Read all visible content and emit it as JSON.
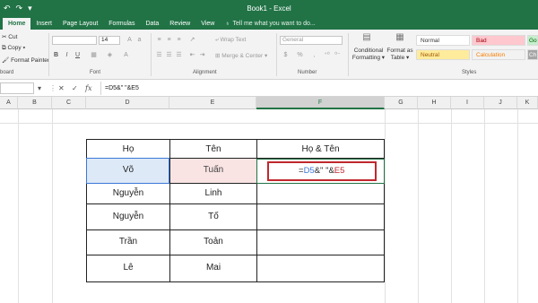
{
  "title_bar": {
    "book_title": "Book1 - Excel"
  },
  "tabs": [
    "Home",
    "Insert",
    "Page Layout",
    "Formulas",
    "Data",
    "Review",
    "View"
  ],
  "tell_me": "Tell me what you want to do...",
  "clipboard": {
    "cut": "Cut",
    "copy": "Copy",
    "format_painter": "Format Painter",
    "label": "board"
  },
  "font": {
    "size": "14",
    "bold": "B",
    "italic": "I",
    "underline": "U",
    "label": "Font"
  },
  "alignment": {
    "wrap_text": "Wrap Text",
    "merge_center": "Merge & Center",
    "label": "Alignment"
  },
  "number": {
    "format": "General",
    "currency": "$",
    "percent": "%",
    "comma": ",",
    "label": "Number"
  },
  "styles": {
    "conditional_formatting": [
      "Conditional",
      "Formatting"
    ],
    "format_as_table": [
      "Format as",
      "Table"
    ],
    "normal": "Normal",
    "bad": "Bad",
    "good": "Go",
    "neutral": "Neutral",
    "calculation": "Calculation",
    "check": "Ch",
    "label": "Styles"
  },
  "formula_bar": {
    "name_box": "",
    "cancel": "✕",
    "enter": "✓",
    "fx": "fx",
    "formula": "=D5&\" \"&E5"
  },
  "columns": [
    "A",
    "B",
    "C",
    "D",
    "E",
    "F",
    "G",
    "H",
    "I",
    "J",
    "K"
  ],
  "table": {
    "headers": [
      "Họ",
      "Tên",
      "Họ & Tên"
    ],
    "rows": [
      [
        "Võ",
        "Tuấn"
      ],
      [
        "Nguyễn",
        "Linh"
      ],
      [
        "Nguyễn",
        "Tố"
      ],
      [
        "Trần",
        "Toản"
      ],
      [
        "Lê",
        "Mai"
      ]
    ],
    "edit_formula": {
      "prefix": "=",
      "ref1": "D5",
      "middle": "&\" \"&",
      "ref2": "E5"
    }
  },
  "colors": {
    "excel_green": "#217346",
    "ref_blue": "#3c78d8",
    "ref_red": "#c0282d"
  }
}
